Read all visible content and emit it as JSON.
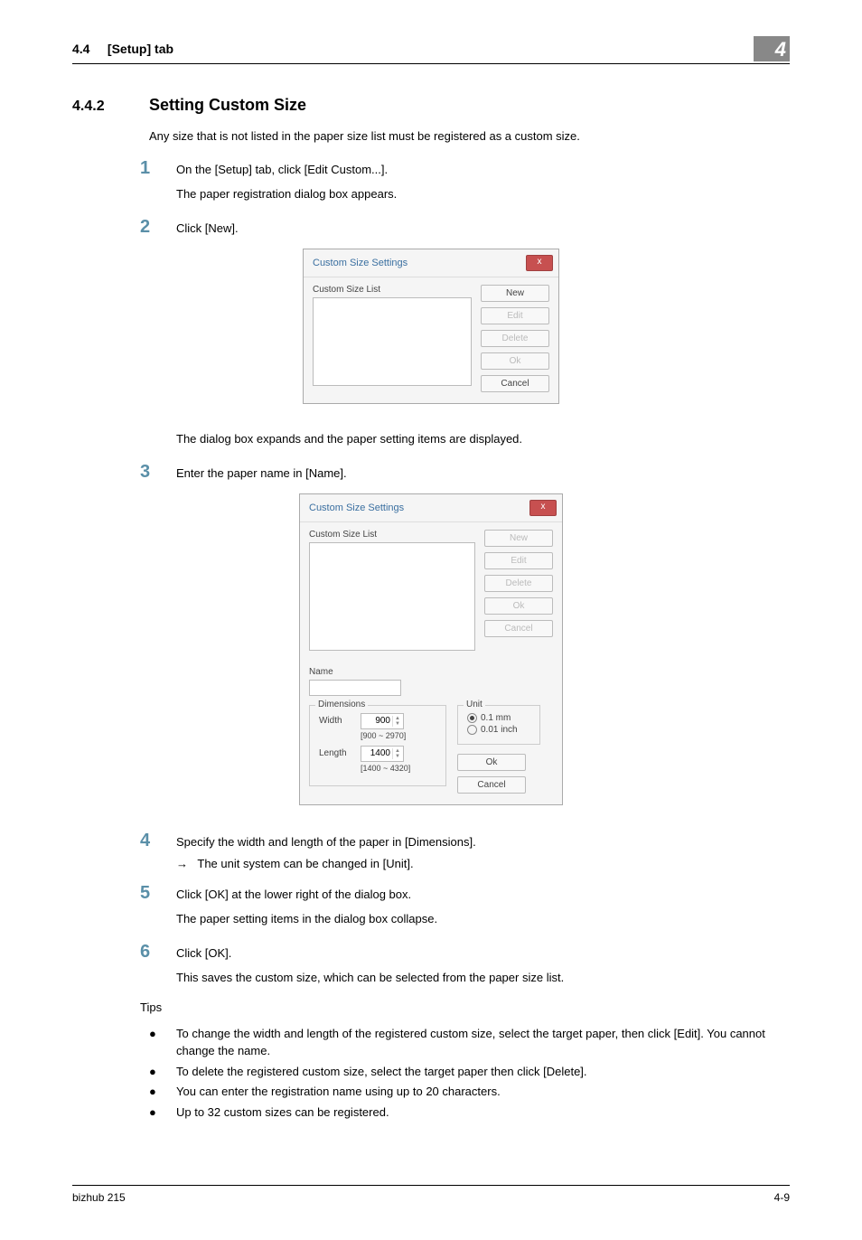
{
  "header": {
    "section_ref": "4.4",
    "section_label": "[Setup] tab",
    "chapter_number": "4"
  },
  "section": {
    "number": "4.4.2",
    "title": "Setting Custom Size",
    "intro": "Any size that is not listed in the paper size list must be registered as a custom size."
  },
  "steps": {
    "s1": {
      "num": "1",
      "text": "On the [Setup] tab, click [Edit Custom...].",
      "follow": "The paper registration dialog box appears."
    },
    "s2": {
      "num": "2",
      "text": "Click [New]."
    },
    "post2": "The dialog box expands and the paper setting items are displayed.",
    "s3": {
      "num": "3",
      "text": "Enter the paper name in [Name]."
    },
    "s4": {
      "num": "4",
      "text": "Specify the width and length of the paper in [Dimensions].",
      "arrow": "The unit system can be changed in [Unit]."
    },
    "s5": {
      "num": "5",
      "text": "Click [OK] at the lower right of the dialog box.",
      "follow": "The paper setting items in the dialog box collapse."
    },
    "s6": {
      "num": "6",
      "text": "Click [OK].",
      "follow": "This saves the custom size, which can be selected from the paper size list."
    }
  },
  "dialog1": {
    "title": "Custom Size Settings",
    "list_label": "Custom Size List",
    "buttons": {
      "new": "New",
      "edit": "Edit",
      "delete": "Delete",
      "ok": "Ok",
      "cancel": "Cancel"
    }
  },
  "dialog2": {
    "title": "Custom Size Settings",
    "list_label": "Custom Size List",
    "buttons": {
      "new": "New",
      "edit": "Edit",
      "delete": "Delete",
      "ok": "Ok",
      "cancel": "Cancel"
    },
    "name_label": "Name",
    "dimensions_label": "Dimensions",
    "width_label": "Width",
    "width_value": "900",
    "width_range": "[900 ~ 2970]",
    "length_label": "Length",
    "length_value": "1400",
    "length_range": "[1400 ~ 4320]",
    "unit_label": "Unit",
    "unit_opt1": "0.1 mm",
    "unit_opt2": "0.01 inch",
    "lower_ok": "Ok",
    "lower_cancel": "Cancel"
  },
  "tips": {
    "label": "Tips",
    "t1": "To change the width and length of the registered custom size, select the target paper, then click [Edit]. You cannot change the name.",
    "t2": "To delete the registered custom size, select the target paper then click [Delete].",
    "t3": "You can enter the registration name using up to 20 characters.",
    "t4": "Up to 32 custom sizes can be registered."
  },
  "footer": {
    "left": "bizhub 215",
    "right": "4-9"
  },
  "glyphs": {
    "arrow": "→",
    "bullet": "●",
    "x": "x"
  }
}
